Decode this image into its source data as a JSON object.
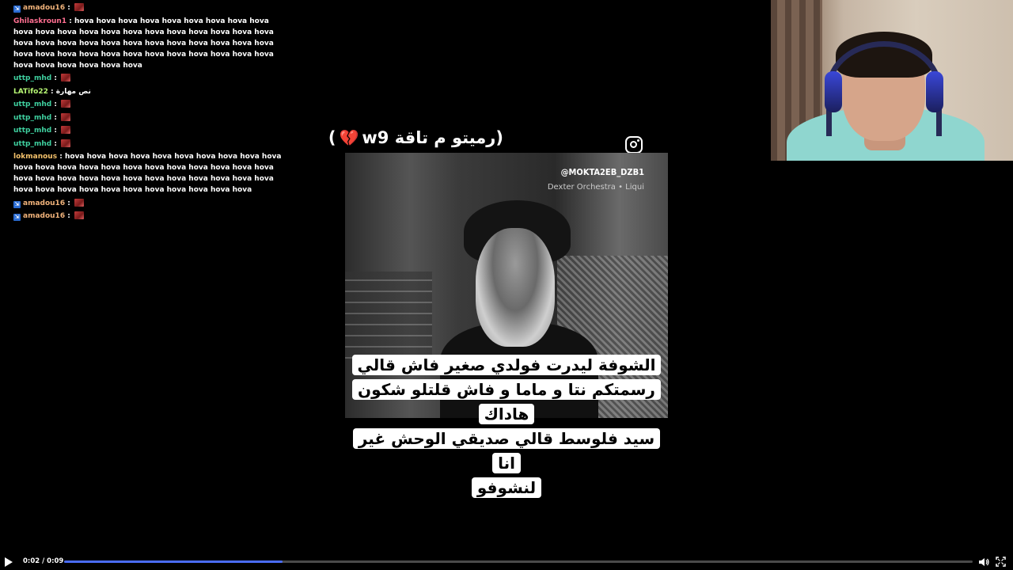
{
  "chat": {
    "messages": [
      {
        "badge": true,
        "user": "amadou16",
        "user_color": "#f0b27a",
        "text": "",
        "emote": true
      },
      {
        "badge": false,
        "user": "Ghilaskroun1",
        "user_color": "#ff6f91",
        "text": "hova hova hova hova hova hova hova hova hova hova hova hova hova hova hova hova hova hova hova hova hova hova hova hova hova hova hova hova hova hova hova hova hova hova hova hova hova hova hova hova hova hova hova hova hova hova hova hova hova hova hova",
        "emote": false
      },
      {
        "badge": false,
        "user": "uttp_mhd",
        "user_color": "#3fd1a0",
        "text": "",
        "emote": true
      },
      {
        "badge": false,
        "user": "LATifo22",
        "user_color": "#b7f774",
        "text": "نص مهارة",
        "emote": false
      },
      {
        "badge": false,
        "user": "uttp_mhd",
        "user_color": "#3fd1a0",
        "text": "",
        "emote": true
      },
      {
        "badge": false,
        "user": "uttp_mhd",
        "user_color": "#3fd1a0",
        "text": "",
        "emote": true
      },
      {
        "badge": false,
        "user": "uttp_mhd",
        "user_color": "#3fd1a0",
        "text": "",
        "emote": true
      },
      {
        "badge": false,
        "user": "uttp_mhd",
        "user_color": "#3fd1a0",
        "text": "",
        "emote": true
      },
      {
        "badge": false,
        "user": "lokmanous",
        "user_color": "#f5c26b",
        "text": "hova hova hova hova hova hova hova hova hova hova hova hova hova hova hova hova hova hova hova hova hova hova hova hova hova hova hova hova hova hova hova hova hova hova hova hova hova hova hova hova hova hova hova hova hova",
        "emote": false
      },
      {
        "badge": true,
        "user": "amadou16",
        "user_color": "#f0b27a",
        "text": "",
        "emote": true
      },
      {
        "badge": true,
        "user": "amadou16",
        "user_color": "#f0b27a",
        "text": "",
        "emote": true
      }
    ]
  },
  "post": {
    "caption": "رميتو م تاقة w9",
    "heart_icon": "broken-heart-icon",
    "instagram_icon": "instagram-icon",
    "handle": "@MOKTA2EB_DZB1",
    "music": "Dexter Orchestra • Liqui",
    "subtitle_lines": [
      "الشوفة ليدرت فولدي صغير فاش قالي",
      "رسمتكم نتا و ماما و فاش قلتلو شكون هاداك",
      "سيد فلوسط قالي صديقي الوحش غير انا",
      "لنشوفو"
    ]
  },
  "player": {
    "time": "0:02 / 0:09",
    "progress": 0.24,
    "accent": "#4a6cf7",
    "play_icon": "play-icon",
    "volume_icon": "volume-icon",
    "fullscreen_icon": "fullscreen-icon"
  }
}
